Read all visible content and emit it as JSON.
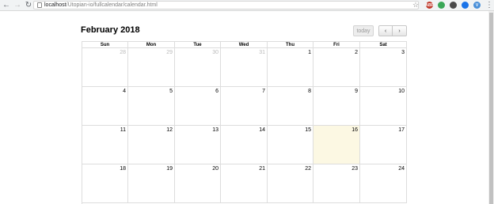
{
  "browser": {
    "back_label": "←",
    "forward_label": "→",
    "reload_label": "↻",
    "url_host": "localhost",
    "url_path": "/Utopian-io/fullcalendar/calendar.html",
    "star_label": "☆",
    "menu_label": "⋮",
    "extensions": [
      {
        "name": "adblock-icon",
        "text": "ABP",
        "color": "#c0392b"
      },
      {
        "name": "extension-green-icon",
        "text": "",
        "color": "#3aa757"
      },
      {
        "name": "pocket-icon",
        "text": "",
        "color": "#4a4a4a"
      },
      {
        "name": "extension-blue-icon",
        "text": "",
        "color": "#1a73e8"
      },
      {
        "name": "vue-devtools-icon",
        "text": "V",
        "color": "#4a90d9"
      }
    ]
  },
  "calendar": {
    "title": "February 2018",
    "today_label": "today",
    "prev_label": "‹",
    "next_label": "›",
    "day_headers": [
      "Sun",
      "Mon",
      "Tue",
      "Wed",
      "Thu",
      "Fri",
      "Sat"
    ],
    "weeks": [
      [
        {
          "d": "28",
          "other": true
        },
        {
          "d": "29",
          "other": true
        },
        {
          "d": "30",
          "other": true
        },
        {
          "d": "31",
          "other": true
        },
        {
          "d": "1"
        },
        {
          "d": "2"
        },
        {
          "d": "3"
        }
      ],
      [
        {
          "d": "4"
        },
        {
          "d": "5"
        },
        {
          "d": "6"
        },
        {
          "d": "7"
        },
        {
          "d": "8"
        },
        {
          "d": "9"
        },
        {
          "d": "10"
        }
      ],
      [
        {
          "d": "11"
        },
        {
          "d": "12"
        },
        {
          "d": "13"
        },
        {
          "d": "14"
        },
        {
          "d": "15"
        },
        {
          "d": "16",
          "today": true
        },
        {
          "d": "17"
        }
      ],
      [
        {
          "d": "18"
        },
        {
          "d": "19"
        },
        {
          "d": "20"
        },
        {
          "d": "21"
        },
        {
          "d": "22"
        },
        {
          "d": "23"
        },
        {
          "d": "24"
        }
      ]
    ],
    "today_highlight_color": "#fcf8e3"
  }
}
